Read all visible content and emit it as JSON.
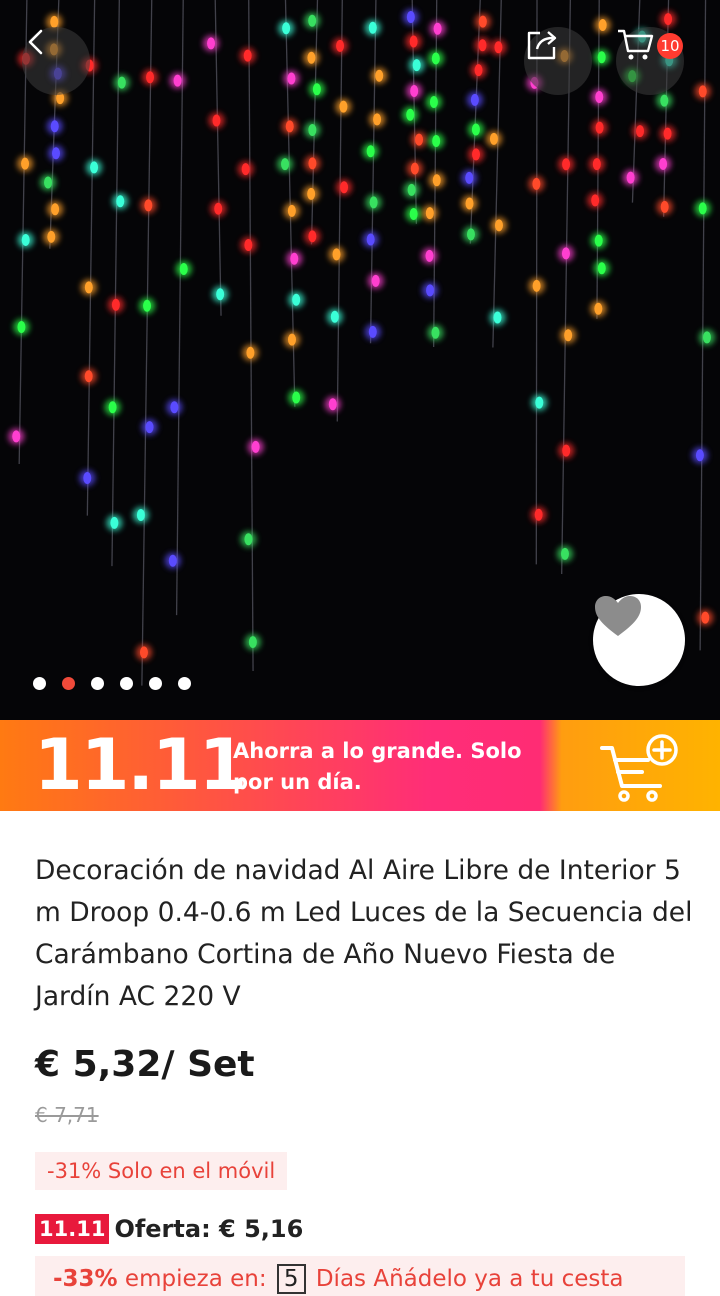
{
  "header": {
    "cart_count": "10"
  },
  "icons": {
    "back": "chevron-left-icon",
    "share": "share-icon",
    "cart": "cart-icon",
    "favorite": "heart-icon",
    "banner_cart": "cart-plus-icon"
  },
  "gallery": {
    "total_images": 6,
    "active_index": 1
  },
  "banner": {
    "logo": "11.11",
    "message": "Ahorra a lo grande. Solo por un día."
  },
  "product": {
    "title": "Decoración de navidad Al Aire Libre de Interior 5 m Droop 0.4-0.6 m Led Luces de la Secuencia del Carámbano Cortina de Año Nuevo Fiesta de Jardín AC 220 V",
    "price": "€ 5,32/ Set",
    "old_price": "€ 7,71",
    "mobile_discount": "-31% Solo en el móvil",
    "offer_badge": "11.11",
    "offer_text": "Oferta: € 5,16",
    "promo": {
      "discount": "-33%",
      "starts_label": "empieza en:",
      "days_number": "5",
      "rest": "Días Añádelo ya a tu cesta"
    }
  },
  "colors": {
    "accent_red": "#e8423a",
    "badge_red": "#ff3b30",
    "banner_pink": "#ff2d78",
    "banner_orange": "#ff9d10"
  }
}
